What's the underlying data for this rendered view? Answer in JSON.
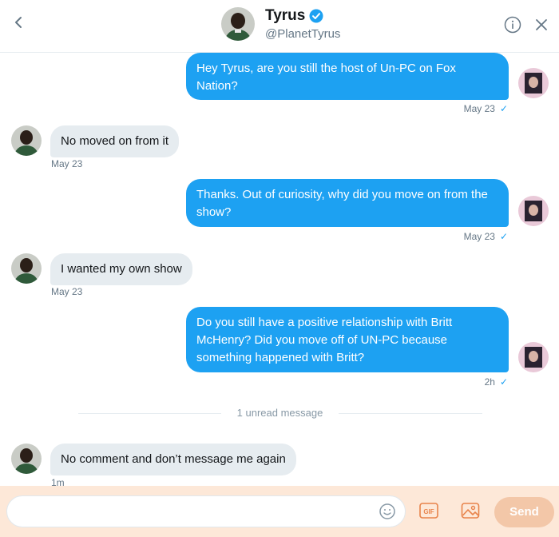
{
  "header": {
    "name": "Tyrus",
    "handle": "@PlanetTyrus"
  },
  "messages": [
    {
      "direction": "out",
      "text": "Hey Tyrus, are you still the host of Un-PC on Fox Nation?",
      "time": "May 23",
      "read": "✓"
    },
    {
      "direction": "in",
      "text": "No moved on from it",
      "time": "May 23"
    },
    {
      "direction": "out",
      "text": "Thanks. Out of curiosity, why did you move on from the show?",
      "time": "May 23",
      "read": "✓"
    },
    {
      "direction": "in",
      "text": "I wanted my own show",
      "time": "May 23"
    },
    {
      "direction": "out",
      "text": "Do you still have a positive relationship with Britt McHenry? Did you move off of UN-PC because something happened with Britt?",
      "time": "2h",
      "read": "✓"
    },
    {
      "direction": "in",
      "text": "No comment and don’t message me again",
      "time": "1m"
    }
  ],
  "divider": "1 unread message",
  "composer": {
    "placeholder": "",
    "gif_label": "GIF",
    "send_label": "Send"
  },
  "colors": {
    "accent": "#1da1f2",
    "incoming_bubble": "#e6ecf0",
    "composer_bg": "#fde8d8",
    "send_disabled": "#f3c7a8"
  },
  "icons": [
    "back-chevron-icon",
    "verified-badge-icon",
    "info-icon",
    "close-icon",
    "emoji-icon",
    "gif-icon",
    "image-icon"
  ]
}
